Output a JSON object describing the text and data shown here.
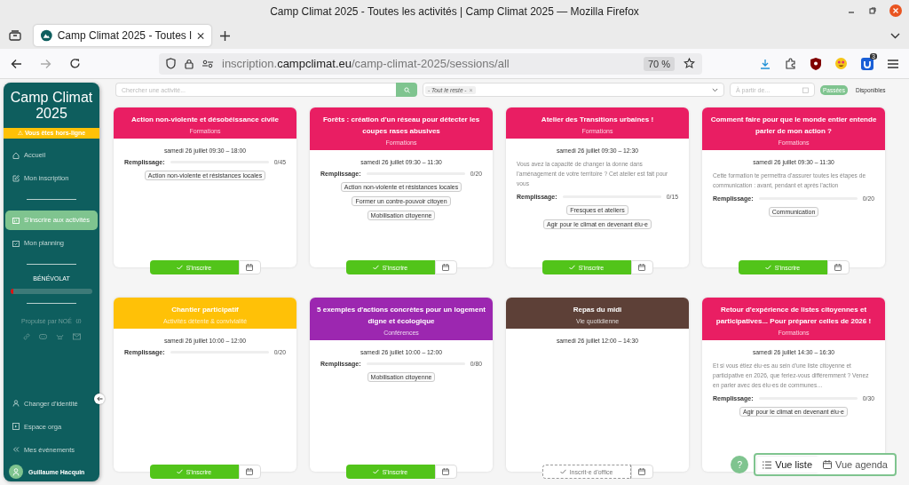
{
  "window": {
    "title": "Camp Climat 2025 - Toutes les activités | Camp Climat 2025 — Mozilla Firefox"
  },
  "tabs": [
    {
      "title": "Camp Climat 2025 - Toutes l",
      "selected": true
    }
  ],
  "address_bar": {
    "subdomain": "inscription.",
    "domain": "campclimat.eu",
    "path": "/camp-climat-2025/sessions/all",
    "zoom": "70 %"
  },
  "extension_badge": "3",
  "sidebar": {
    "title": "Camp Climat 2025",
    "offline_banner": {
      "icon": "⚠",
      "text": "Vous êtes hors-ligne"
    },
    "items": [
      {
        "kind": "home",
        "label": "Accueil",
        "selected": false
      },
      {
        "kind": "edit",
        "label": "Mon inscription",
        "selected": false
      },
      {
        "kind": "divider"
      },
      {
        "kind": "calendar",
        "label": "S'inscrire aux activités",
        "selected": true
      },
      {
        "kind": "planning",
        "label": "Mon planning",
        "selected": false
      }
    ],
    "section": "BÉNÉVOLAT",
    "volunteer_progress": {
      "level": 0.03
    },
    "powered_by": "Propulsé par NOÉ",
    "bottom_items": [
      {
        "kind": "person",
        "label": "Changer d'identité"
      },
      {
        "kind": "box",
        "label": "Espace orga"
      },
      {
        "kind": "back",
        "label": "Mes événements"
      }
    ],
    "user": "Guillaume Hacquin"
  },
  "filters": {
    "search_placeholder": "Chercher une activité...",
    "tag": "- Tout le reste -",
    "tag_remove": "×",
    "date_placeholder": "À partir de...",
    "toggles": [
      {
        "label": "Passées",
        "on": true
      },
      {
        "label": "Disponibles",
        "on": false
      }
    ]
  },
  "cards": [
    {
      "title": "Action non-violente et désobéissance civile",
      "category": "Formations",
      "color": "#e91e63",
      "date": "samedi 26 juillet 09:30 – 18:00",
      "fill_label": "Remplissage:",
      "level": 0,
      "count": "0/45",
      "tags": [
        "Action non-violente et résistances locales"
      ],
      "button": {
        "kind": "register",
        "label": "S'inscrire"
      }
    },
    {
      "title": "Forêts : création d'un réseau pour détecter les coupes rases abusives",
      "category": "Formations",
      "color": "#e91e63",
      "date": "samedi 26 juillet 09:30 – 11:30",
      "fill_label": "Remplissage:",
      "level": 0,
      "count": "0/20",
      "tags": [
        "Action non-violente et résistances locales",
        "Former un contre-pouvoir citoyen",
        "Mobilisation citoyenne"
      ],
      "button": {
        "kind": "register",
        "label": "S'inscrire"
      }
    },
    {
      "title": "Atelier des Transitions urbaines !",
      "category": "Formations",
      "color": "#e91e63",
      "date": "samedi 26 juillet 09:30 – 12:30",
      "description": "Vous avez la capacité de changer la donne dans l'aménagement de votre territoire ? Cet atelier est fait pour vous",
      "fill_label": "Remplissage:",
      "level": 0,
      "count": "0/15",
      "tags": [
        "Fresques et ateliers",
        "Agir pour le climat en devenant élu·e"
      ],
      "button": {
        "kind": "register",
        "label": "S'inscrire"
      }
    },
    {
      "title": "Comment faire pour que le monde entier entende parler de mon action ?",
      "category": "Formations",
      "color": "#e91e63",
      "date": "samedi 26 juillet 09:30 – 11:30",
      "description": "Cette formation te permettra d'assurer toutes les étapes de communication : avant, pendant et après l'action",
      "fill_label": "Remplissage:",
      "level": 0,
      "count": "0/20",
      "tags": [
        "Communication"
      ],
      "button": {
        "kind": "register",
        "label": "S'inscrire"
      }
    },
    {
      "title": "Chantier participatif",
      "category": "Activités détente & convivialité",
      "color": "#ffc107",
      "date": "samedi 26 juillet 10:00 – 12:00",
      "fill_label": "Remplissage:",
      "level": 0,
      "count": "0/20",
      "button": {
        "kind": "register",
        "label": "S'inscrire"
      }
    },
    {
      "title": "5 exemples d'actions concrètes pour un logement digne et écologique",
      "category": "Conférences",
      "color": "#9c27b0",
      "date": "samedi 26 juillet 10:00 – 12:00",
      "fill_label": "Remplissage:",
      "level": 0,
      "count": "0/80",
      "tags": [
        "Mobilisation citoyenne"
      ],
      "button": {
        "kind": "register",
        "label": "S'inscrire"
      }
    },
    {
      "title": "Repas du midi",
      "category": "Vie quotidienne",
      "color": "#5d4037",
      "date": "samedi 26 juillet 12:00 – 14:30",
      "button": {
        "kind": "auto",
        "label": "Inscrit·e d'office"
      }
    },
    {
      "title": "Retour d'expérience de listes citoyennes et participatives... Pour préparer celles de 2026 !",
      "category": "Formations",
      "color": "#e91e63",
      "date": "samedi 26 juillet 14:30 – 16:30",
      "description": "Et si vous étiez élu·es au sein d'une liste citoyenne et participative en 2026, que feriez-vous différemment ? Venez en parler avec des élu·es de communes…",
      "fill_label": "Remplissage:",
      "level": 0,
      "count": "0/30",
      "tags": [
        "Agir pour le climat en devenant élu·e"
      ]
    }
  ],
  "help_button": "?",
  "views": [
    {
      "kind": "list",
      "label": "Vue liste",
      "selected": true
    },
    {
      "kind": "agenda",
      "label": "Vue agenda",
      "selected": false
    }
  ]
}
